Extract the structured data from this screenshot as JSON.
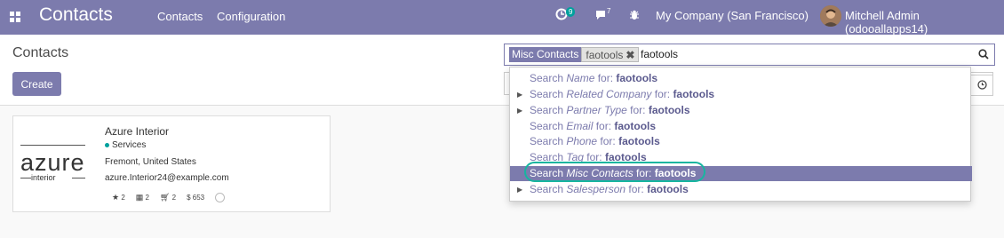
{
  "navbar": {
    "brand": "Contacts",
    "menu": [
      "Contacts",
      "Configuration"
    ],
    "activity_count": "9",
    "messages_count": "7",
    "company": "My Company (San Francisco)",
    "user": "Mitchell Admin (odooallapps14)"
  },
  "control": {
    "title": "Contacts",
    "create_label": "Create"
  },
  "search": {
    "facet_category": "Misc Contacts",
    "facet_value": "faotools",
    "query": "faotools"
  },
  "dropdown": {
    "items": [
      {
        "prefix": "Search ",
        "field": "Name",
        "mid": " for: ",
        "term": "faotools",
        "expandable": false
      },
      {
        "prefix": "Search ",
        "field": "Related Company",
        "mid": " for: ",
        "term": "faotools",
        "expandable": true
      },
      {
        "prefix": "Search ",
        "field": "Partner Type",
        "mid": " for: ",
        "term": "faotools",
        "expandable": true
      },
      {
        "prefix": "Search ",
        "field": "Email",
        "mid": " for: ",
        "term": "faotools",
        "expandable": false
      },
      {
        "prefix": "Search ",
        "field": "Phone",
        "mid": " for: ",
        "term": "faotools",
        "expandable": false
      },
      {
        "prefix": "Search ",
        "field": "Tag",
        "mid": " for: ",
        "term": "faotools",
        "expandable": false
      },
      {
        "prefix": "Search ",
        "field": "Misc Contacts",
        "mid": " for: ",
        "term": "faotools",
        "expandable": false
      },
      {
        "prefix": "Search ",
        "field": "Salesperson",
        "mid": " for: ",
        "term": "faotools",
        "expandable": true
      }
    ]
  },
  "card": {
    "logo_main": "azure",
    "logo_sub": "interior",
    "name": "Azure Interior",
    "tag": "Services",
    "address": "Fremont, United States",
    "email": "azure.Interior24@example.com",
    "stats": {
      "stars": "2",
      "meetings": "2",
      "sales": "2",
      "invoiced": "$ 653"
    }
  }
}
